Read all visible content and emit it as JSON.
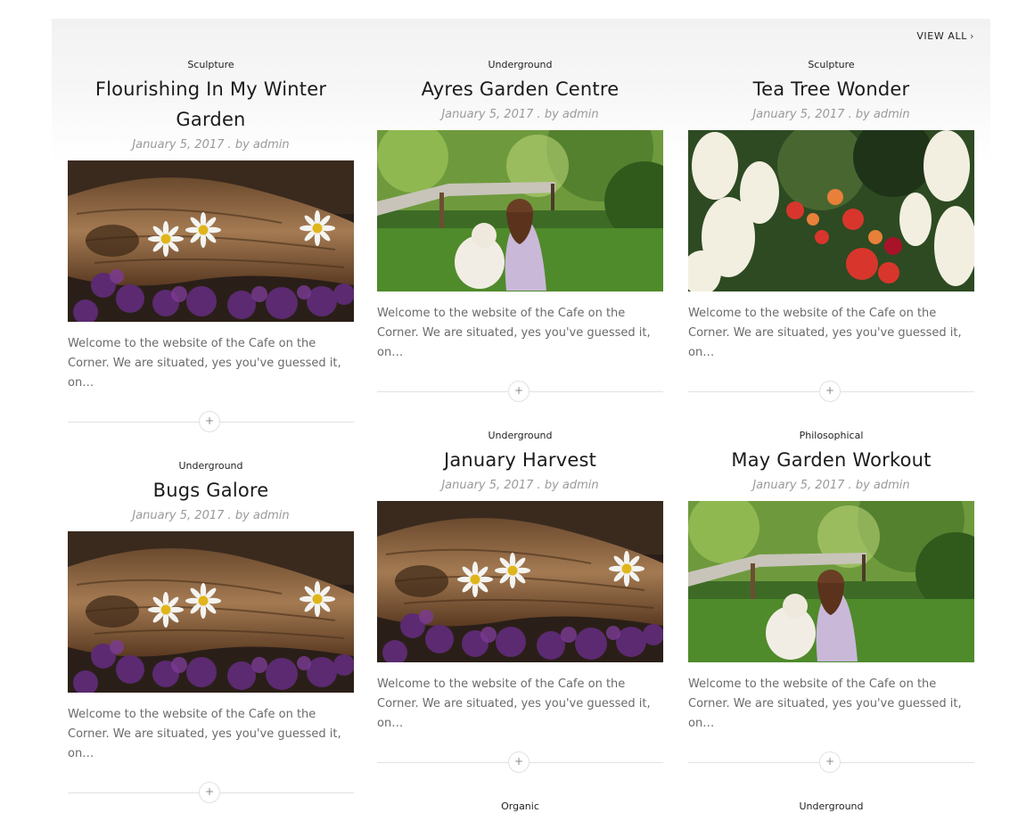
{
  "header": {
    "view_all_label": "VIEW ALL",
    "view_all_icon": "chevron-right-icon"
  },
  "posts": [
    {
      "category": "Sculpture",
      "title": "Flourishing In My Winter Garden",
      "date": "January 5, 2017",
      "sep": ".",
      "by": "by",
      "author": "admin",
      "image": "daisies-on-wood",
      "excerpt": "Welcome to the website of the Cafe on the Corner. We are situated, yes you've guessed it, on…"
    },
    {
      "category": "Ayres Garden Centre"
    },
    {
      "category": "Underground",
      "title": "Ayres Garden Centre",
      "date": "January 5, 2017",
      "sep": ".",
      "by": "by",
      "author": "admin",
      "image": "girl-with-dog",
      "excerpt": "Welcome to the website of the Cafe on the Corner. We are situated, yes you've guessed it, on…"
    },
    {
      "category": "Sculpture",
      "title": "Tea Tree Wonder",
      "date": "January 5, 2017",
      "sep": ".",
      "by": "by",
      "author": "admin",
      "image": "garden-flowers",
      "excerpt": "Welcome to the website of the Cafe on the Corner. We are situated, yes you've guessed it, on…"
    },
    {
      "category": "Underground",
      "title": "Bugs Galore",
      "date": "January 5, 2017",
      "sep": ".",
      "by": "by",
      "author": "admin",
      "image": "daisies-on-wood",
      "excerpt": "Welcome to the website of the Cafe on the Corner. We are situated, yes you've guessed it, on…"
    },
    {
      "category": "Underground",
      "title": "January Harvest",
      "date": "January 5, 2017",
      "sep": ".",
      "by": "by",
      "author": "admin",
      "image": "daisies-on-wood",
      "excerpt": "Welcome to the website of the Cafe on the Corner. We are situated, yes you've guessed it, on…"
    },
    {
      "category": "Philosophical",
      "title": "May Garden Workout",
      "date": "January 5, 2017",
      "sep": ".",
      "by": "by",
      "author": "admin",
      "image": "girl-with-dog",
      "excerpt": "Welcome to the website of the Cafe on the Corner. We are situated, yes you've guessed it, on…"
    },
    {
      "category": "Organic"
    },
    {
      "category": "Underground"
    }
  ],
  "more_icon": "plus-icon",
  "more_symbol": "+"
}
